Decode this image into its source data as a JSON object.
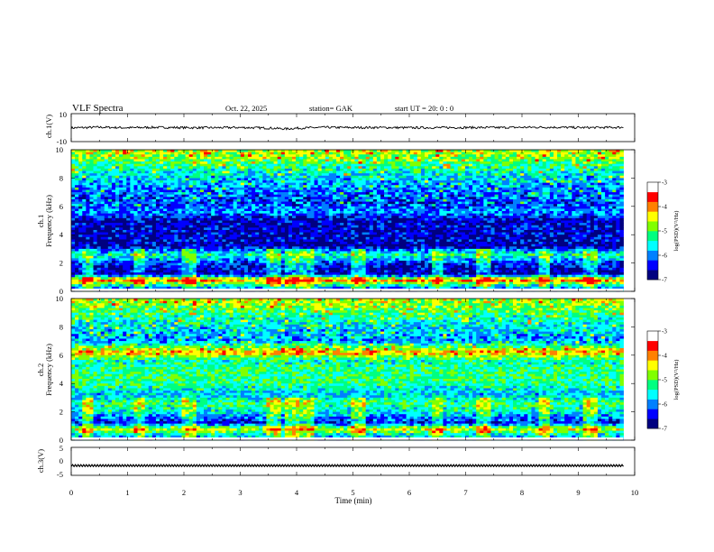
{
  "header": {
    "title": "VLF  Spectra",
    "date": "Oct. 22, 2025",
    "station": "station= GAK",
    "start": "start  UT  =    20: 0   : 0"
  },
  "panels": {
    "ch1_label": "ch.1(V)",
    "spec1_label": "ch.1",
    "spec2_label": "ch.2",
    "ch3_label": "ch.3(V)",
    "freq_label": "Frequency (kHz)"
  },
  "colorbar": {
    "label": "log(PSD)(V²/Hz)",
    "ticks": [
      "-3",
      "-4",
      "-5",
      "-6",
      "-7"
    ],
    "colors": [
      "#000080",
      "#0000ff",
      "#0080ff",
      "#00ffff",
      "#00ff80",
      "#80ff00",
      "#ffff00",
      "#ff8000",
      "#ff0000",
      "#ffffff"
    ]
  },
  "chart_data": [
    {
      "type": "line",
      "name": "ch1-waveform",
      "ylabel": "ch.1(V)",
      "ylim": [
        -10,
        10
      ],
      "yticks": [
        "10",
        "-10"
      ],
      "x": [
        0,
        0.5,
        1,
        1.5,
        2,
        2.5,
        3,
        3.5,
        3.8,
        4,
        4.5,
        5,
        5.5,
        6,
        6.5,
        7,
        7.5,
        8,
        8.5,
        9,
        9.5,
        9.8
      ],
      "values": [
        -0.2,
        0.3,
        -0.1,
        0.2,
        0.0,
        -0.1,
        0.1,
        -0.3,
        -0.9,
        -0.4,
        0.2,
        0.0,
        0.1,
        -0.1,
        0.0,
        0.1,
        0.0,
        0.2,
        0.3,
        0.0,
        0.1,
        0.2
      ]
    },
    {
      "type": "heatmap",
      "name": "ch1-spectrogram",
      "ylabel": "Frequency (kHz)",
      "ylim": [
        0,
        10
      ],
      "yticks": [
        "10",
        "8",
        "6",
        "4",
        "2",
        "0"
      ],
      "clim": [
        -7,
        -3
      ],
      "profile_freq_khz": [
        0.3,
        0.8,
        1.2,
        2.0,
        2.6,
        3.2,
        4.0,
        5.0,
        5.6,
        6.2,
        7.0,
        8.0,
        9.0,
        9.8
      ],
      "profile_log_psd": [
        -5.8,
        -3.5,
        -6.7,
        -6.2,
        -5.2,
        -6.6,
        -6.5,
        -6.6,
        -5.8,
        -6.2,
        -6.0,
        -5.6,
        -5.0,
        -4.4
      ],
      "bursts_min": [
        0.3,
        1.2,
        2.1,
        3.6,
        3.9,
        4.2,
        5.1,
        6.5,
        7.3,
        8.4,
        9.2
      ]
    },
    {
      "type": "heatmap",
      "name": "ch2-spectrogram",
      "ylabel": "Frequency (kHz)",
      "ylim": [
        0,
        10
      ],
      "yticks": [
        "10",
        "8",
        "6",
        "4",
        "2",
        "0"
      ],
      "clim": [
        -7,
        -3
      ],
      "profile_freq_khz": [
        0.3,
        0.8,
        1.2,
        2.0,
        2.6,
        3.2,
        4.0,
        5.0,
        5.6,
        6.2,
        7.0,
        8.0,
        9.0,
        9.8
      ],
      "profile_log_psd": [
        -5.6,
        -4.2,
        -6.4,
        -5.4,
        -5.0,
        -5.6,
        -5.0,
        -5.0,
        -5.2,
        -3.9,
        -5.9,
        -5.5,
        -5.0,
        -4.4
      ],
      "bursts_min": [
        0.3,
        1.2,
        2.1,
        3.6,
        3.9,
        4.2,
        5.1,
        6.5,
        7.3,
        8.4,
        9.2
      ]
    },
    {
      "type": "line",
      "name": "ch3-waveform",
      "ylabel": "ch.3(V)",
      "ylim": [
        -5,
        5
      ],
      "yticks": [
        "5",
        "0",
        "-5"
      ],
      "x": [
        0,
        9.8
      ],
      "values": [
        -1.5,
        -1.5
      ]
    }
  ],
  "xaxis": {
    "label": "Time  (min)",
    "xlim": [
      0,
      10
    ],
    "ticks": [
      "0",
      "1",
      "2",
      "3",
      "4",
      "5",
      "6",
      "7",
      "8",
      "9",
      "10"
    ]
  }
}
